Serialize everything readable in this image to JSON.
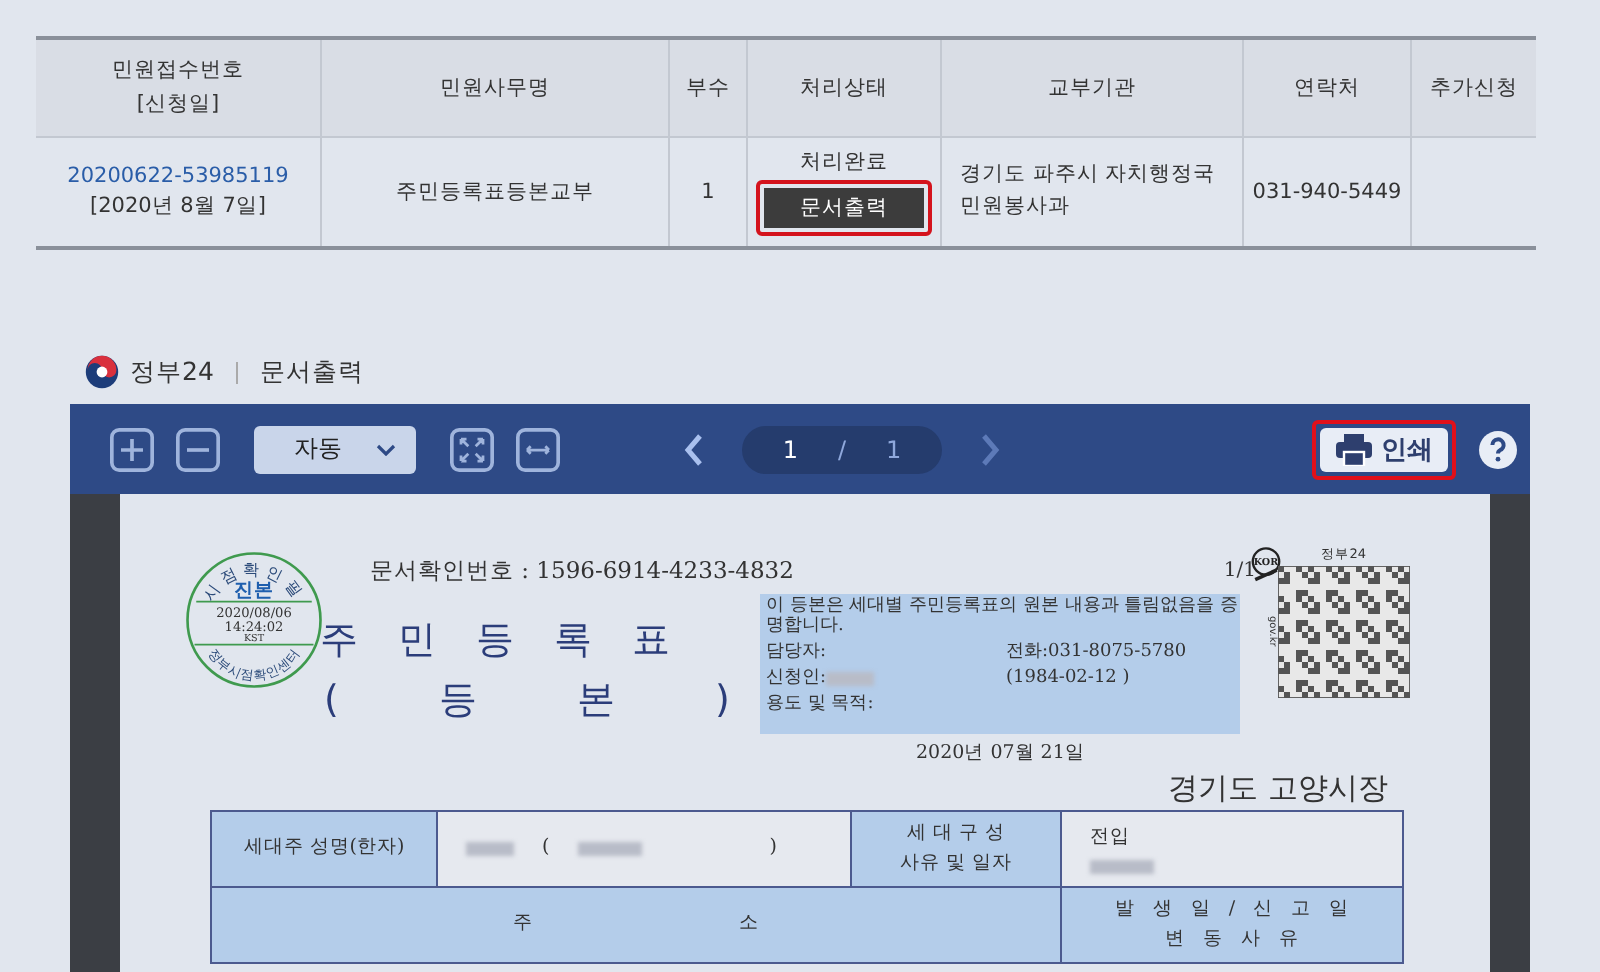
{
  "records_table": {
    "columns": [
      {
        "label": "민원접수번호",
        "sublabel": "[신청일]"
      },
      {
        "label": "민원사무명"
      },
      {
        "label": "부수"
      },
      {
        "label": "처리상태"
      },
      {
        "label": "교부기관"
      },
      {
        "label": "연락처"
      },
      {
        "label": "추가신청"
      }
    ],
    "rows": [
      {
        "receipt_no": "20200622-53985119",
        "applied_date": "[2020년 8월 7일]",
        "service_name": "주민등록표등본교부",
        "copies": "1",
        "status": "처리완료",
        "print_button": {
          "label": "문서출력",
          "highlighted": true
        },
        "issuing_agency": "경기도 파주시 자치행정국 민원봉사과",
        "contact": "031-940-5449"
      }
    ]
  },
  "viewer": {
    "brand": "정부24",
    "title": "문서출력",
    "toolbar": {
      "zoom_select": "자동",
      "page": "1",
      "separator": "/",
      "total_pages": "1",
      "print_button": {
        "label": "인쇄",
        "highlighted": true
      }
    },
    "document": {
      "confirm_number": "문서확인번호 : 1596-6914-4233-4832",
      "stamp": {
        "top_text": "시점확인필",
        "center_text": "진본",
        "date": "2020/08/06",
        "time": "14:24:02",
        "zone": "KST",
        "bottom_text": "정부시점확인센터"
      },
      "title": "주 민 등 록 표",
      "subtitle": "( 등 본 )",
      "certificate": {
        "statement": "이 등본은 세대별 주민등록표의 원본 내용과 틀림없음을 증명합니다.",
        "officer_label": "담당자:",
        "phone": "전화:031-8075-5780",
        "applicant_label": "신청인:",
        "applicant_birth": "(1984-02-12 )",
        "purpose_label": "용도 및 목적:"
      },
      "page_indicator": "1/1",
      "badge_text": "KOR",
      "qr_label": "정부24",
      "qr_side_text": "gov.kr",
      "issue_date": "2020년 07월 21일",
      "issuer": "경기도 고양시장",
      "household_table": {
        "head_name_label": "세대주 성명(한자)",
        "name_open": "(",
        "name_close": ")",
        "composition_label_lines": [
          "세 대 구 성",
          "사유 및 일자"
        ],
        "composition_value": "전입",
        "address_label": "주 소",
        "date_header_lines": [
          "발 생 일 / 신 고 일",
          "변 동 사 유"
        ]
      }
    }
  }
}
